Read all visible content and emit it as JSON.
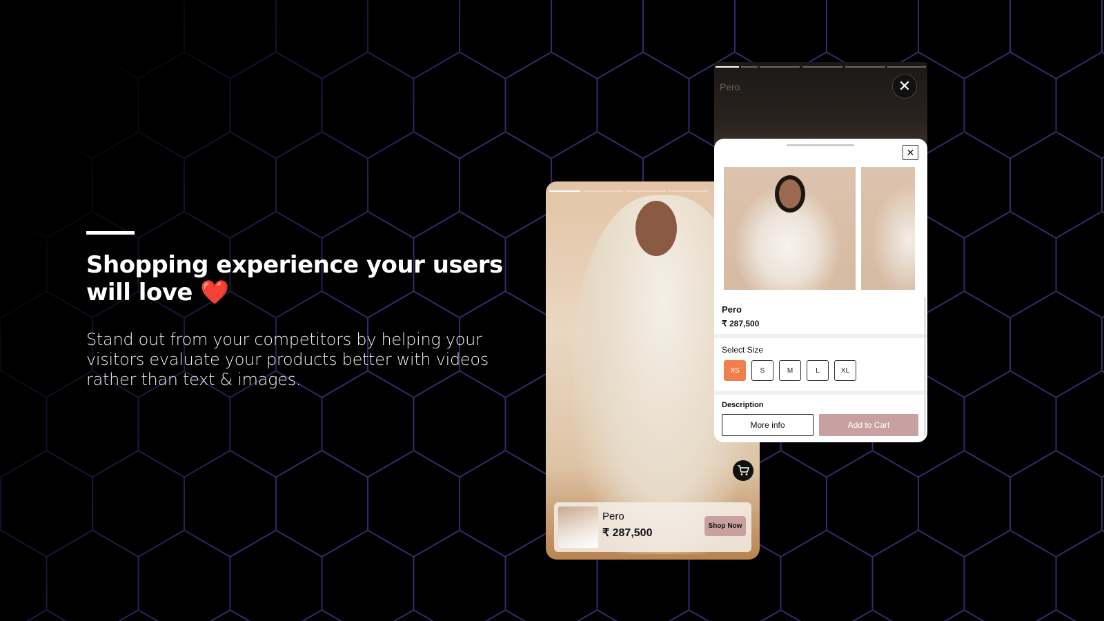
{
  "hero": {
    "heading": "Shopping experience your users will love",
    "heart": "❤️",
    "description": "Stand out from your competitors by helping your visitors evaluate your products better with videos rather than text & images."
  },
  "colors": {
    "hex_grid": "#2f2c6e",
    "accent_size": "#ef7f4d",
    "button_rose": "#c9a0a0"
  },
  "story_card": {
    "product_name": "Pero",
    "product_price": "₹ 287,500",
    "shop_button": "Shop Now",
    "cart_icon": "shopping-cart-icon"
  },
  "product_sheet": {
    "story_title": "Pero",
    "close_icon": "close-icon",
    "product_name": "Pero",
    "product_price": "₹ 287,500",
    "select_size_label": "Select Size",
    "sizes": [
      "XS",
      "S",
      "M",
      "L",
      "XL"
    ],
    "selected_size": "XS",
    "description_label": "Description",
    "more_info_button": "More info",
    "add_to_cart_button": "Add to Cart"
  }
}
